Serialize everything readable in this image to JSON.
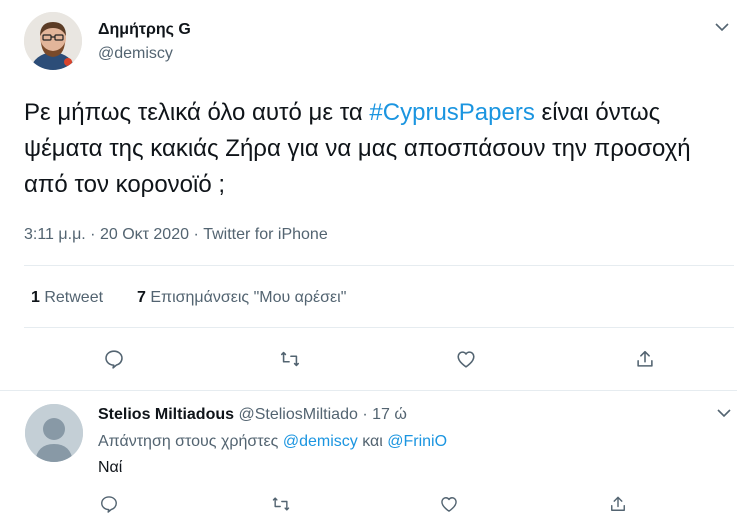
{
  "tweet": {
    "author_name": "Δημήτρης G",
    "author_handle": "@demiscy",
    "text_part1": "Ρε μήπως τελικά όλο αυτό με τα ",
    "hashtag": "#CyprusPapers",
    "text_part2": " είναι όντως ψέματα της κακιάς Ζήρα για να μας αποσπάσουν την προσοχή από τον κορονοϊό ;",
    "timestamp": "3:11 μ.μ. · 20 Οκτ 2020 · Twitter for iPhone",
    "retweet_count": "1",
    "retweet_label": " Retweet",
    "like_count": "7",
    "like_label": " Επισημάνσεις \"Μου αρέσει\""
  },
  "reply": {
    "author_name": "Stelios Miltiadous",
    "author_handle": "@SteliosMiltiado",
    "time": "· 17 ώ",
    "reply_to_prefix": "Απάντηση στους χρήστες ",
    "mention1": "@demiscy",
    "reply_to_join": " και ",
    "mention2": "@FriniO",
    "text": "Ναί"
  },
  "icons": {
    "reply": "speech-bubble-icon",
    "retweet": "retweet-arrows-icon",
    "like": "heart-icon",
    "share": "share-upload-icon",
    "more": "chevron-down-icon"
  },
  "colors": {
    "link": "#1b95e0",
    "secondary_text": "#536471",
    "divider": "#e6ecf0"
  }
}
